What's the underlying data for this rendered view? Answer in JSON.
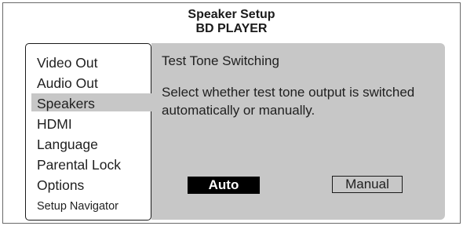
{
  "header": {
    "title": "Speaker Setup",
    "subtitle": "BD PLAYER"
  },
  "menu": {
    "items": [
      {
        "label": "Video Out",
        "selected": false
      },
      {
        "label": "Audio Out",
        "selected": false
      },
      {
        "label": "Speakers",
        "selected": true
      },
      {
        "label": "HDMI",
        "selected": false
      },
      {
        "label": "Language",
        "selected": false
      },
      {
        "label": "Parental Lock",
        "selected": false
      },
      {
        "label": "Options",
        "selected": false
      },
      {
        "label": "Setup Navigator",
        "selected": false
      }
    ]
  },
  "panel": {
    "heading": "Test Tone Switching",
    "description": "Select whether test tone output is switched automatically or manually.",
    "options": [
      {
        "label": "Auto",
        "selected": true
      },
      {
        "label": "Manual",
        "selected": false
      }
    ]
  },
  "colors": {
    "panel_background": "#c7c7c7",
    "selected_option_background": "#000000",
    "selected_option_text": "#ffffff",
    "text": "#1f1f1f"
  }
}
